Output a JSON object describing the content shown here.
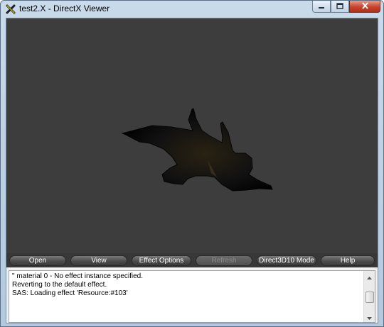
{
  "window": {
    "title": "test2.X - DirectX Viewer",
    "app_icon": "directx-x-icon",
    "controls": [
      "minimize-icon",
      "maximize-icon",
      "close-icon"
    ]
  },
  "viewport": {
    "background": "#3d3d3d",
    "content": "3D model silhouette"
  },
  "toolbar": {
    "buttons": [
      {
        "label": "Open",
        "enabled": true
      },
      {
        "label": "View",
        "enabled": true
      },
      {
        "label": "Effect Options",
        "enabled": true
      },
      {
        "label": "Refresh",
        "enabled": false
      },
      {
        "label": "Direct3D10 Mode",
        "enabled": true
      },
      {
        "label": "Help",
        "enabled": true
      }
    ]
  },
  "console": {
    "lines": [
      "\" material 0 - No effect instance specified.",
      "Reverting to the default effect.",
      "SAS: Loading effect 'Resource:#103'"
    ]
  },
  "colors": {
    "titlebar": "#c9daea",
    "close_button": "#c7432d",
    "toolbar": "#383838"
  }
}
